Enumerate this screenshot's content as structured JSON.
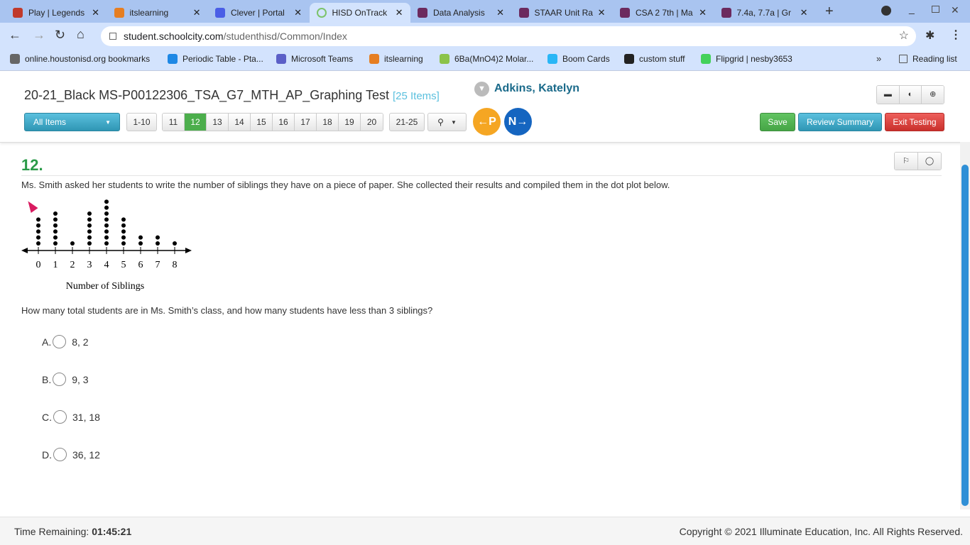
{
  "browser": {
    "tabs": [
      {
        "title": "Play | Legends",
        "icon": "legends-icon",
        "color": "#c0392b"
      },
      {
        "title": "itslearning",
        "icon": "itslearning-icon",
        "color": "#e67e22"
      },
      {
        "title": "Clever | Portal",
        "icon": "clever-icon",
        "color": "#4a5ee6"
      },
      {
        "title": "HISD OnTrack",
        "icon": "loading-icon",
        "color": "#7cc36a",
        "active": true
      },
      {
        "title": "Data Analysis",
        "icon": "quizizz-icon",
        "color": "#6c2a5e"
      },
      {
        "title": "STAAR Unit Ra",
        "icon": "quizizz-icon",
        "color": "#6c2a5e"
      },
      {
        "title": "CSA 2 7th | Ma",
        "icon": "quizizz-icon",
        "color": "#6c2a5e"
      },
      {
        "title": "7.4a, 7.7a | Gr",
        "icon": "quizizz-icon",
        "color": "#6c2a5e"
      }
    ],
    "url_host": "student.schoolcity.com",
    "url_path": "/studenthisd/Common/Index",
    "bookmarks": [
      {
        "label": "online.houstonisd.org bookmarks",
        "color": "#666"
      },
      {
        "label": "Periodic Table - Pta...",
        "color": "#1e88e5"
      },
      {
        "label": "Microsoft Teams",
        "color": "#5b5fc7"
      },
      {
        "label": "itslearning",
        "color": "#e67e22"
      },
      {
        "label": "6Ba(MnO4)2 Molar...",
        "color": "#8bc34a"
      },
      {
        "label": "Boom Cards",
        "color": "#29b6f6"
      },
      {
        "label": "custom stuff",
        "color": "#222"
      },
      {
        "label": "Flipgrid | nesby3653",
        "color": "#43d15a"
      }
    ],
    "reading_list": "Reading list"
  },
  "test": {
    "title": "20-21_Black MS-P00122306_TSA_G7_MTH_AP_Graphing Test",
    "item_count": "[25 Items]",
    "student": "Adkins, Katelyn",
    "filter": "All Items",
    "range_prev": "1-10",
    "pages": [
      "11",
      "12",
      "13",
      "14",
      "15",
      "16",
      "17",
      "18",
      "19",
      "20"
    ],
    "current_page": "12",
    "range_next": "21-25",
    "prev_label": "P",
    "next_label": "N",
    "save": "Save",
    "review": "Review Summary",
    "exit": "Exit Testing"
  },
  "question": {
    "number": "12.",
    "stem": "Ms. Smith asked her students to write the number of siblings they have on a piece of paper. She collected their results and compiled them in the dot plot below.",
    "prompt": "How many total students are in Ms. Smith’s class, and how many students have less than 3 siblings?",
    "choices": [
      {
        "letter": "A.",
        "text": "8, 2"
      },
      {
        "letter": "B.",
        "text": "9, 3"
      },
      {
        "letter": "C.",
        "text": "31, 18"
      },
      {
        "letter": "D.",
        "text": "36, 12"
      }
    ]
  },
  "chart_data": {
    "type": "scatter",
    "subtype": "dot plot",
    "categories": [
      "0",
      "1",
      "2",
      "3",
      "4",
      "5",
      "6",
      "7",
      "8"
    ],
    "values": [
      5,
      6,
      1,
      6,
      8,
      5,
      2,
      2,
      1
    ],
    "xlabel": "Number of Siblings",
    "ylabel": ""
  },
  "footer": {
    "time_label": "Time Remaining:",
    "time_value": "01:45:21",
    "copyright": "Copyright © 2021 Illuminate Education, Inc. All Rights Reserved."
  }
}
